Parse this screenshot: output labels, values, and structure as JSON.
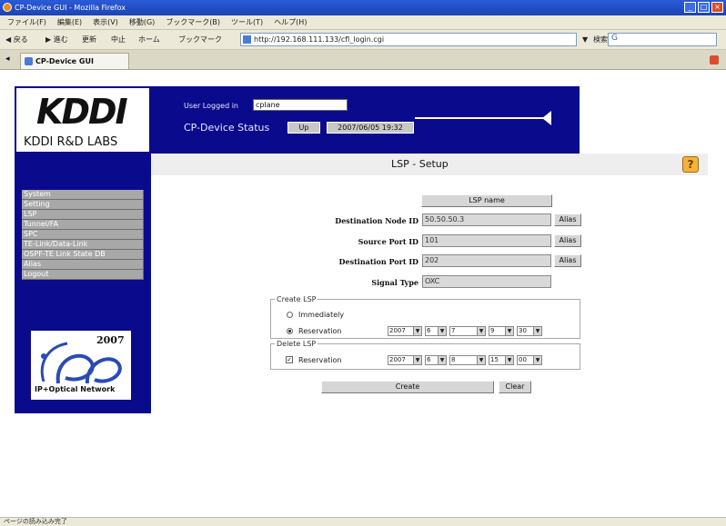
{
  "window": {
    "title": "CP-Device GUI - Mozilla Firefox"
  },
  "menubar": [
    "ファイル(F)",
    "編集(E)",
    "表示(V)",
    "移動(G)",
    "ブックマーク(B)",
    "ツール(T)",
    "ヘルプ(H)"
  ],
  "navbar": {
    "back": "戻る",
    "forward": "進む",
    "reload": "更新",
    "stop": "中止",
    "home": "ホーム",
    "bookmarks": "ブックマーク",
    "url": "http://192.168.111.133/cfl_login.cgi",
    "search_button": "検索"
  },
  "tab": {
    "label": "CP-Device GUI"
  },
  "header": {
    "logo": "KDDI",
    "logo_sub": "KDDI R&D LABS",
    "user_label": "User Logged in",
    "user_value": "cplane",
    "status_label": "CP-Device Status",
    "status_value": "Up",
    "status_time": "2007/06/05 19:32"
  },
  "sidebar": {
    "items": [
      {
        "label": "System"
      },
      {
        "label": "Setting"
      },
      {
        "label": "LSP"
      },
      {
        "label": "Tunnel/FA"
      },
      {
        "label": "SPC"
      },
      {
        "label": "TE-Link/Data-Link"
      },
      {
        "label": "OSPF-TE Link State DB"
      },
      {
        "label": "Alias"
      },
      {
        "label": "Logout"
      }
    ],
    "banner": {
      "year": "2007",
      "caption": "IP+Optical Network"
    }
  },
  "main": {
    "title": "LSP - Setup",
    "lsp_name_button": "LSP name",
    "alias_button": "Alias",
    "fields": {
      "dest_node": {
        "label": "Destination Node ID",
        "value": "50.50.50.3"
      },
      "src_port": {
        "label": "Source Port ID",
        "value": "101"
      },
      "dest_port": {
        "label": "Destination Port ID",
        "value": "202"
      },
      "signal": {
        "label": "Signal Type",
        "value": "OXC"
      }
    },
    "create_lsp": {
      "legend": "Create LSP",
      "immediately": "Immediately",
      "reservation": "Reservation",
      "values": [
        "2007",
        "6",
        "7",
        "9",
        "30"
      ]
    },
    "delete_lsp": {
      "legend": "Delete LSP",
      "reservation": "Reservation",
      "values": [
        "2007",
        "6",
        "8",
        "15",
        "00"
      ]
    },
    "create_button": "Create",
    "clear_button": "Clear"
  },
  "statusbar": {
    "text": "ページの読み込み完了"
  }
}
